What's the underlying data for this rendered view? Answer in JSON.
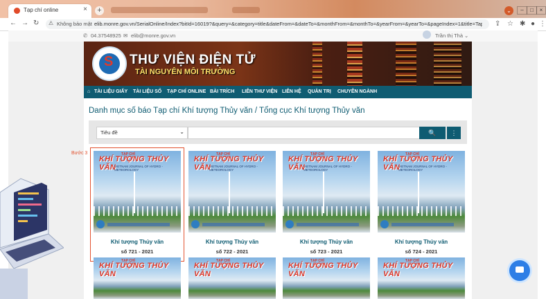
{
  "browser": {
    "tab_title": "Tạp chí online",
    "tab_close": "×",
    "new_tab": "+",
    "insecure_label": "Không bảo mật",
    "url": "elib.monre.gov.vn/SerialOnline/Index?bitId=16019?&query=&category=title&dateFrom=&dateTo=&monthFrom=&monthTo=&yearFrom=&yearTo=&pageIndex=1&title=Tap%20c..."
  },
  "contact": {
    "phone": "04.37548925",
    "email": "elib@monre.gov.vn",
    "user": "Trần thị Thà"
  },
  "banner": {
    "title": "THƯ VIỆN ĐIỆN TỬ",
    "subtitle": "TÀI NGUYÊN MÔI TRƯỜNG"
  },
  "menu": [
    "TÀI LIỆU GIẤY",
    "TÀI LIỆU SỐ",
    "TẠP CHÍ ONLINE",
    "BÀI TRÍCH",
    "LIÊN THƯ VIỆN",
    "LIÊN HỆ",
    "QUẢN TRỊ",
    "CHUYÊN NGÀNH"
  ],
  "page_title": "Danh mục số báo Tạp chí Khí tượng Thủy văn / Tổng cục Khí tượng Thủy văn",
  "search": {
    "field": "Tiêu đề",
    "search_icon": "search-icon",
    "more_icon": "more-vertical-icon"
  },
  "step_label": "Bước 3",
  "cover": {
    "top_text": "TẠP CHÍ",
    "brand": "KHÍ TƯỢNG THỦY VĂN",
    "brand_bottom": "VIETNAM JOURNAL OF HYDRO - METEOROLOGY"
  },
  "issues": [
    {
      "name": "Khí tượng Thủy văn",
      "number": "số 721 - 2021"
    },
    {
      "name": "Khí tượng Thủy văn",
      "number": "số 722 - 2021"
    },
    {
      "name": "Khí tượng Thủy văn",
      "number": "số 723 - 2021"
    },
    {
      "name": "Khí tượng Thủy văn",
      "number": "số 724 - 2021"
    }
  ],
  "colors": {
    "accent": "#0f5c72",
    "highlight": "#e2522f",
    "chat": "#2d7ee6"
  }
}
